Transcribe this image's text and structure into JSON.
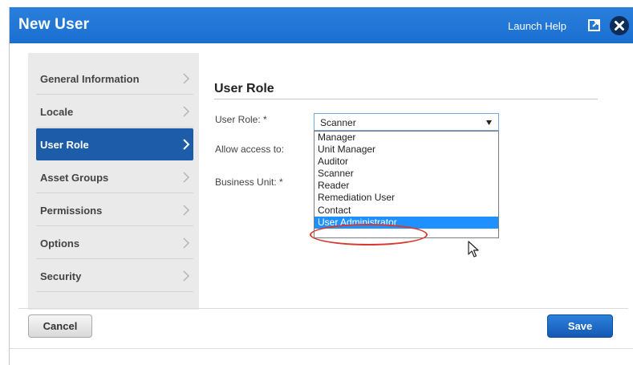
{
  "dialog": {
    "title": "New User",
    "launch_help": "Launch Help",
    "icons": {
      "popout": "popout-icon",
      "close": "close-icon"
    },
    "accent_color": "#1a6fd1"
  },
  "nav": {
    "items": [
      {
        "label": "General Information",
        "active": false
      },
      {
        "label": "Locale",
        "active": false
      },
      {
        "label": "User Role",
        "active": true
      },
      {
        "label": "Asset Groups",
        "active": false
      },
      {
        "label": "Permissions",
        "active": false
      },
      {
        "label": "Options",
        "active": false
      },
      {
        "label": "Security",
        "active": false
      }
    ]
  },
  "form": {
    "section_title": "User Role",
    "fields": {
      "user_role_label": "User Role: *",
      "allow_access_label": "Allow access to:",
      "business_unit_label": "Business Unit: *"
    },
    "user_role_select": {
      "value": "Scanner",
      "options": [
        "Manager",
        "Unit Manager",
        "Auditor",
        "Scanner",
        "Reader",
        "Remediation User",
        "Contact",
        "User Administrator"
      ],
      "highlighted": "User Administrator"
    }
  },
  "footer": {
    "cancel_label": "Cancel",
    "save_label": "Save"
  }
}
